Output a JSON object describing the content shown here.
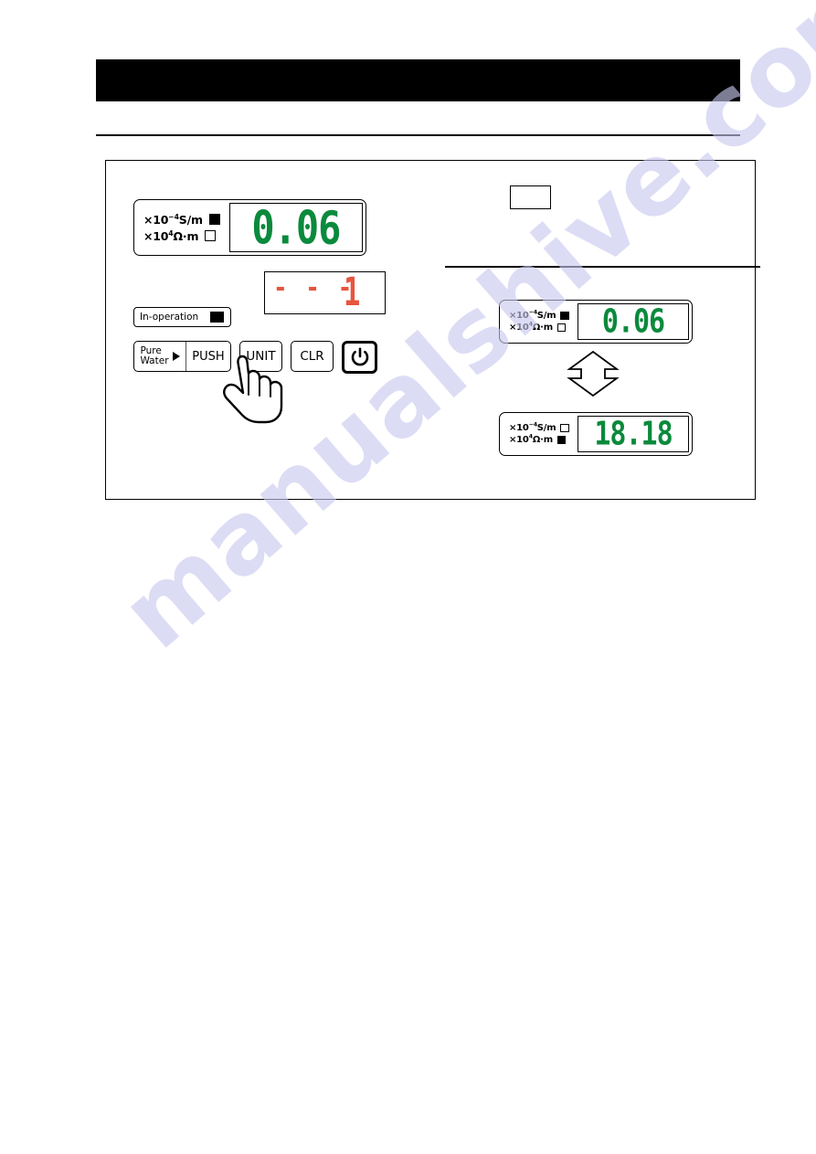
{
  "document": {
    "header_bar": "",
    "watermark": "manualshive.com"
  },
  "figure": {
    "callout_box_text": "",
    "main_meter": {
      "name": "main-conductivity-meter",
      "unit_rows": [
        {
          "label_prefix": "×10",
          "exponent": "-4",
          "label_suffix": "S/m",
          "led": "on"
        },
        {
          "label_prefix": "×10",
          "exponent": "4",
          "label_suffix": "Ω·m",
          "led": "off"
        }
      ],
      "value": "0.06"
    },
    "sub_display": {
      "dashes": "- - -",
      "digit": "1",
      "color": "#e8533f"
    },
    "in_operation": {
      "label": "In-operation",
      "led": "on"
    },
    "buttons": {
      "pure_water": {
        "line1": "Pure",
        "line2": "Water",
        "arrow": "▶"
      },
      "push": "PUSH",
      "unit": "UNIT",
      "clr": "CLR",
      "power": "power-symbol"
    },
    "hand_cursor": {
      "target": "UNIT"
    },
    "toggle_arrow": {
      "direction": "up-down"
    },
    "right_meters": [
      {
        "name": "conductivity-mode-meter",
        "unit_rows": [
          {
            "label_prefix": "×10",
            "exponent": "-4",
            "label_suffix": "S/m",
            "led": "on"
          },
          {
            "label_prefix": "×10",
            "exponent": "4",
            "label_suffix": "Ω·m",
            "led": "off"
          }
        ],
        "value": "0.06"
      },
      {
        "name": "resistivity-mode-meter",
        "unit_rows": [
          {
            "label_prefix": "×10",
            "exponent": "-4",
            "label_suffix": "S/m",
            "led": "off"
          },
          {
            "label_prefix": "×10",
            "exponent": "4",
            "label_suffix": "Ω·m",
            "led": "on"
          }
        ],
        "value": "18.18"
      }
    ]
  },
  "colors": {
    "led_green": "#0a8a3c",
    "led_red": "#e8533f",
    "outline": "#000000",
    "watermark": "#c9c8ef"
  }
}
